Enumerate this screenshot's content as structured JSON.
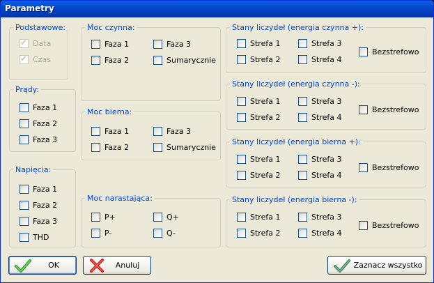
{
  "window": {
    "title": "Parametry"
  },
  "groups": {
    "podstawowe": {
      "label": "Podstawowe:",
      "items": [
        "Data",
        "Czas"
      ]
    },
    "prady": {
      "label": "Prądy:",
      "items": [
        "Faza 1",
        "Faza 2",
        "Faza 3"
      ]
    },
    "napiecia": {
      "label": "Napięcia:",
      "items": [
        "Faza 1",
        "Faza 2",
        "Faza 3",
        "THD"
      ]
    },
    "moc_czynna": {
      "label": "Moc czynna:",
      "items": [
        "Faza 1",
        "Faza 3",
        "Faza 2",
        "Sumarycznie"
      ]
    },
    "moc_bierna": {
      "label": "Moc bierna:",
      "items": [
        "Faza 1",
        "Faza 3",
        "Faza 2",
        "Sumarycznie"
      ]
    },
    "moc_narastajaca": {
      "label": "Moc narastająca:",
      "items": [
        "P+",
        "Q+",
        "P-",
        "Q-"
      ]
    },
    "czynna_plus": {
      "label": "Stany liczydeł (energia czynna +):",
      "items": [
        "Strefa 1",
        "Strefa 3",
        "Strefa 2",
        "Strefa 4",
        "Bezstrefowo"
      ]
    },
    "czynna_minus": {
      "label": "Stany liczydeł (energia czynna -):",
      "items": [
        "Strefa 1",
        "Strefa 3",
        "Strefa 2",
        "Strefa 4",
        "Bezstrefowo"
      ]
    },
    "bierna_plus": {
      "label": "Stany liczydeł (energia bierna +):",
      "items": [
        "Strefa 1",
        "Strefa 3",
        "Strefa 2",
        "Strefa 4",
        "Bezstrefowo"
      ]
    },
    "bierna_minus": {
      "label": "Stany liczydeł (energia bierna -):",
      "items": [
        "Strefa 1",
        "Strefa 3",
        "Strefa 2",
        "Strefa 4",
        "Bezstrefowo"
      ]
    }
  },
  "buttons": {
    "ok": "OK",
    "cancel": "Anuluj",
    "select_all": "Zaznacz wszystko"
  },
  "colors": {
    "group_label": "#0046d5",
    "face": "#ece9d8",
    "titlebar": "#0647c8"
  }
}
